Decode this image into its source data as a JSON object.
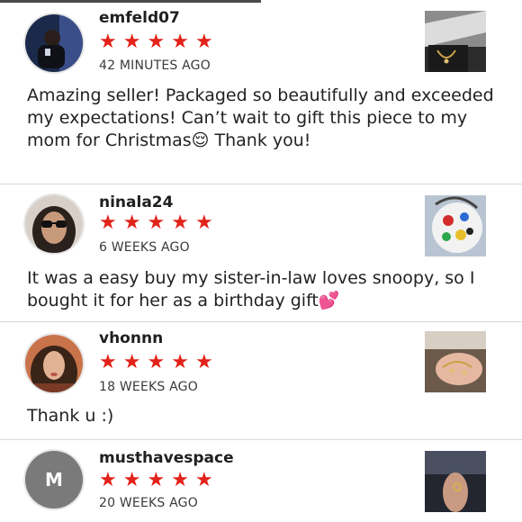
{
  "reviews": [
    {
      "username": "emfeld07",
      "rating": 5,
      "time": "42 MINUTES AGO",
      "text": "Amazing seller! Packaged so beautifully and exceeded my expectations! Can’t wait to gift this piece to my mom for Christmas😌 Thank you!",
      "avatar_icon": "user-photo-avatar",
      "thumb_icon": "packaged-necklace-photo"
    },
    {
      "username": "ninala24",
      "rating": 5,
      "time": "6 WEEKS AGO",
      "text": "It was a easy buy my sister-in-law loves snoopy, so I bought it for her as a birthday gift💕",
      "avatar_icon": "user-photo-avatar",
      "thumb_icon": "snoopy-bag-photo"
    },
    {
      "username": "vhonnn",
      "rating": 5,
      "time": "18 WEEKS AGO",
      "text": "Thank u :)",
      "avatar_icon": "user-photo-avatar",
      "thumb_icon": "jewelry-in-hand-photo"
    },
    {
      "username": "musthavespace",
      "rating": 5,
      "avatar_initial": "M",
      "time": "20 WEEKS AGO",
      "text": "",
      "thumb_icon": "ring-on-hand-photo"
    }
  ],
  "star_glyph": "★",
  "colors": {
    "star": "#e2231a",
    "divider": "#d9d9d9",
    "text": "#222222",
    "initial_avatar_bg": "#7a7a7a"
  }
}
